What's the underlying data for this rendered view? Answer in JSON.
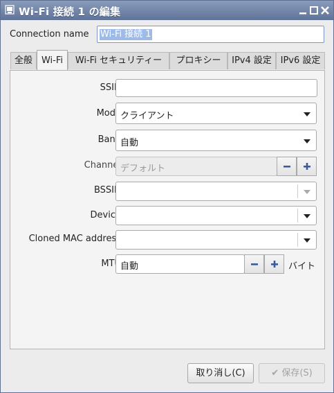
{
  "window": {
    "title": "Wi-Fi 接続 1 の編集",
    "controls": [
      "minimize-icon",
      "maximize-icon",
      "close-icon"
    ]
  },
  "connection": {
    "label": "Connection name",
    "value": "Wi-Fi 接続 1"
  },
  "tabs": [
    {
      "label": "全般"
    },
    {
      "label": "Wi-Fi",
      "active": true
    },
    {
      "label": "Wi-Fi セキュリティー"
    },
    {
      "label": "プロキシー"
    },
    {
      "label": "IPv4 設定"
    },
    {
      "label": "IPv6 設定"
    }
  ],
  "form": {
    "ssid": {
      "label": "SSID",
      "value": ""
    },
    "mode": {
      "label": "Mode",
      "value": "クライアント"
    },
    "band": {
      "label": "Band",
      "value": "自動"
    },
    "channel": {
      "label": "Channel",
      "value": "デフォルト"
    },
    "bssid": {
      "label": "BSSID",
      "value": ""
    },
    "device": {
      "label": "Device",
      "value": ""
    },
    "cloned_mac": {
      "label": "Cloned MAC address",
      "value": ""
    },
    "mtu": {
      "label": "MTU",
      "value": "自動",
      "unit": "バイト"
    }
  },
  "buttons": {
    "cancel": "取り消し(C)",
    "save": "保存(S)"
  }
}
